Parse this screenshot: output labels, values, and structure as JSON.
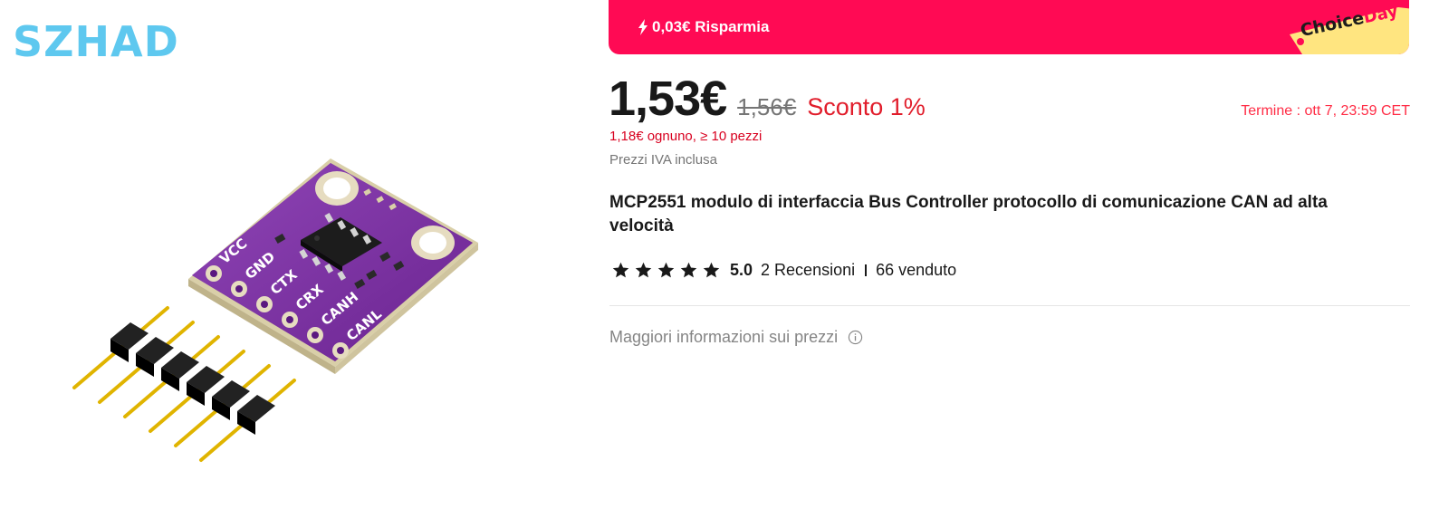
{
  "store": {
    "brand": "SZHAD"
  },
  "banner": {
    "savings_text": "0,03€ Risparmia",
    "choice_label": "Choice",
    "day_label": "Day",
    "colors": {
      "banner_bg": "#ff0a54",
      "tag_bg": "#ffe580"
    }
  },
  "price": {
    "current": "1,53€",
    "original": "1,56€",
    "discount": "Sconto 1%",
    "bulk": "1,18€ ognuno, ≥ 10 pezzi",
    "vat_note": "Prezzi IVA inclusa",
    "deadline": "Termine :  ott 7, 23:59 CET"
  },
  "product": {
    "title": "MCP2551 modulo di interfaccia Bus Controller protocollo di comunicazione CAN ad alta velocità",
    "image_pin_labels": [
      "VCC",
      "GND",
      "CTX",
      "CRX",
      "CANH",
      "CANL"
    ]
  },
  "reviews": {
    "stars": 5,
    "score": "5.0",
    "count_text": "2 Recensioni",
    "sold_text": "66 venduto"
  },
  "pricing_info": {
    "label": "Maggiori informazioni sui prezzi",
    "icon": "info-circle-icon"
  }
}
